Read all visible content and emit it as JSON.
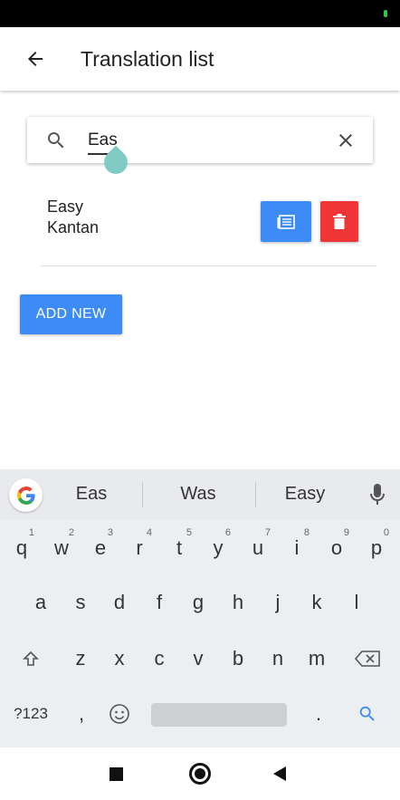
{
  "app_bar": {
    "title": "Translation list"
  },
  "search": {
    "value": "Eas",
    "placeholder": ""
  },
  "list": {
    "items": [
      {
        "source": "Easy",
        "target": "Kantan"
      }
    ]
  },
  "actions": {
    "add_new_label": "ADD NEW"
  },
  "keyboard": {
    "suggestions": [
      "Eas",
      "Was",
      "Easy"
    ],
    "row1": [
      {
        "key": "q",
        "hint": "1"
      },
      {
        "key": "w",
        "hint": "2"
      },
      {
        "key": "e",
        "hint": "3"
      },
      {
        "key": "r",
        "hint": "4"
      },
      {
        "key": "t",
        "hint": "5"
      },
      {
        "key": "y",
        "hint": "6"
      },
      {
        "key": "u",
        "hint": "7"
      },
      {
        "key": "i",
        "hint": "8"
      },
      {
        "key": "o",
        "hint": "9"
      },
      {
        "key": "p",
        "hint": "0"
      }
    ],
    "row2": [
      "a",
      "s",
      "d",
      "f",
      "g",
      "h",
      "j",
      "k",
      "l"
    ],
    "row3": [
      "z",
      "x",
      "c",
      "v",
      "b",
      "n",
      "m"
    ],
    "symbols_label": "?123",
    "comma_label": ",",
    "period_label": "."
  },
  "colors": {
    "primary": "#3d8bf7",
    "danger": "#ef3535",
    "handle": "#80cbc4"
  }
}
